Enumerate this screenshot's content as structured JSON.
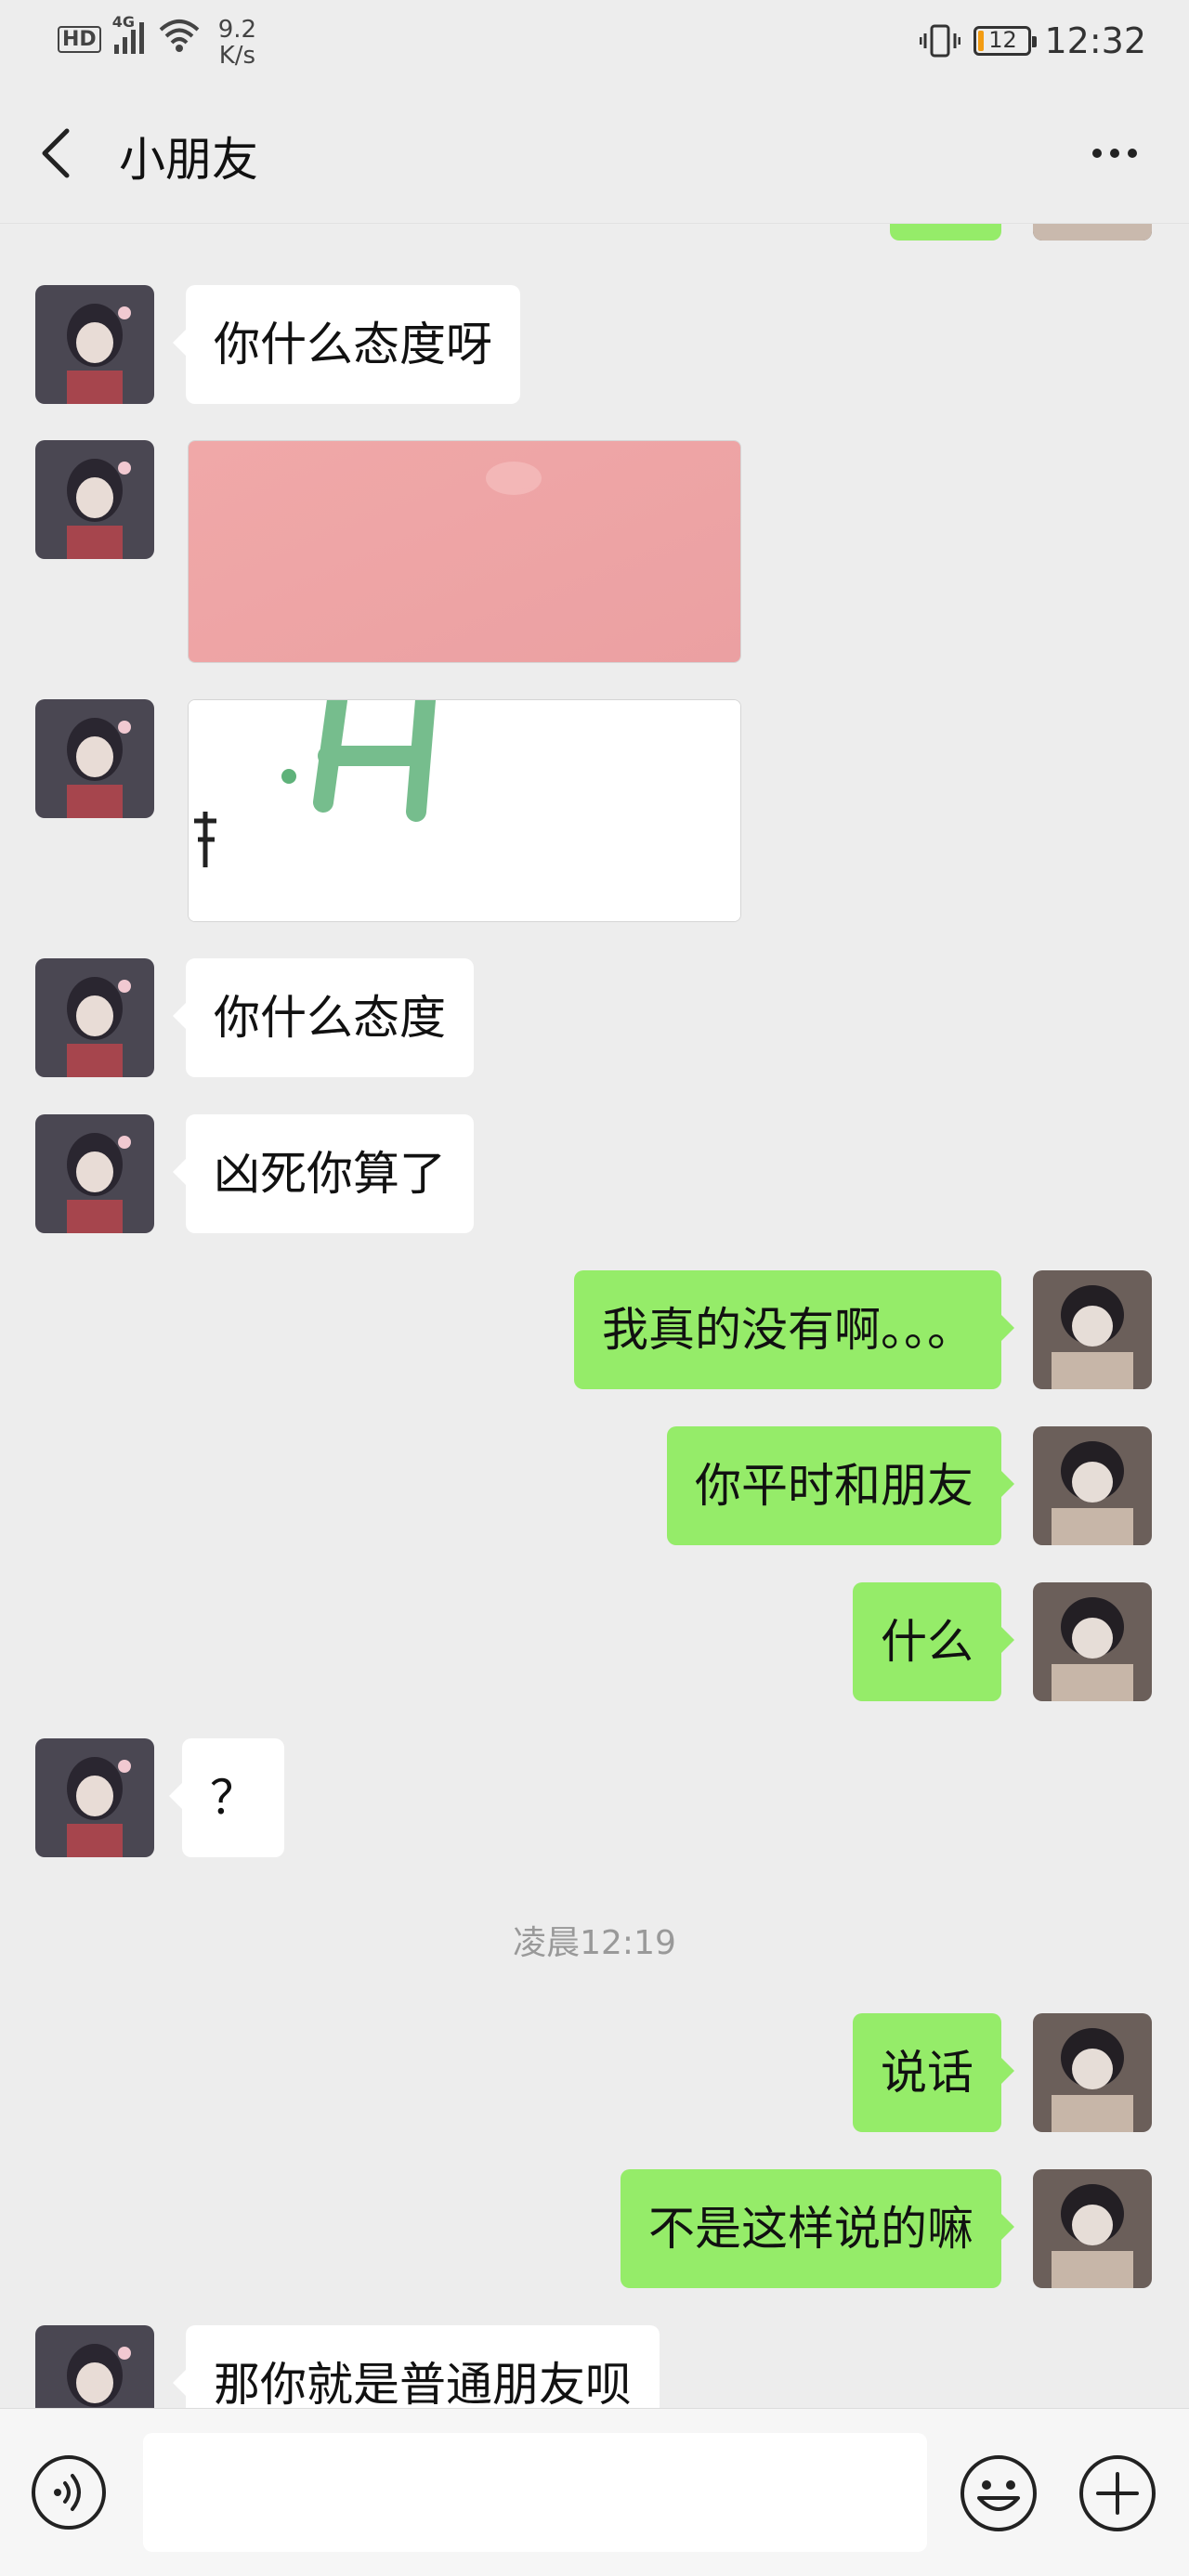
{
  "status_bar": {
    "hd": "HD",
    "network": "4G",
    "speed_value": "9.2",
    "speed_unit": "K/s",
    "battery_level": "12",
    "battery_fraction": 0.12,
    "time": "12:32"
  },
  "nav": {
    "title": "小朋友",
    "back_icon": "chevron-left-icon",
    "more_icon": "more-dots-icon"
  },
  "messages": [
    {
      "side": "in",
      "text": "你什么态度呀"
    },
    {
      "side": "in",
      "type": "image",
      "description_icon": "pink-image"
    },
    {
      "side": "in",
      "type": "image",
      "description_icon": "sticker-image"
    },
    {
      "side": "in",
      "text": "你什么态度"
    },
    {
      "side": "in",
      "text": "凶死你算了"
    },
    {
      "side": "out",
      "text": "我真的没有啊。。。"
    },
    {
      "side": "out",
      "text": "你平时和朋友"
    },
    {
      "side": "out",
      "text": "什么"
    },
    {
      "side": "in",
      "text": "？"
    },
    {
      "type": "time",
      "text": "凌晨12:19"
    },
    {
      "side": "out",
      "text": "说话"
    },
    {
      "side": "out",
      "text": "不是这样说的嘛"
    },
    {
      "side": "in",
      "text": "那你就是普通朋友呗"
    }
  ],
  "colors": {
    "background": "#ededed",
    "outgoing_bubble": "#95ec69",
    "incoming_bubble": "#ffffff",
    "battery": "#f39c12"
  },
  "input_bar": {
    "voice_icon": "voice-icon",
    "emoji_icon": "emoji-icon",
    "plus_icon": "plus-icon",
    "value": ""
  }
}
